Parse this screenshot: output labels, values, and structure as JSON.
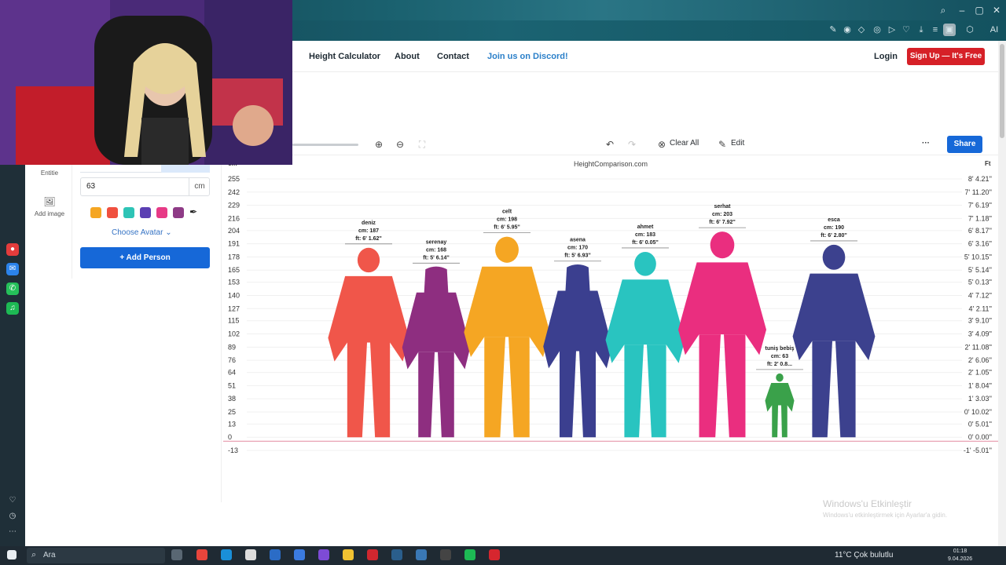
{
  "browser": {
    "ai_label": "AI"
  },
  "nav": {
    "links": [
      "Height Calculator",
      "About",
      "Contact"
    ],
    "discord": "Join us on Discord!",
    "login": "Login",
    "signup": "Sign Up — It's Free"
  },
  "toolbar": {
    "clear_all": "Clear All",
    "edit": "Edit",
    "share": "Share",
    "more": "···"
  },
  "left_panel": {
    "rail_entities": "Entitie",
    "rail_add_image": "Add image",
    "height_value": "63",
    "unit": "cm",
    "choose_avatar": "Choose Avatar",
    "add_person": "+ Add Person",
    "colors": [
      "#f5a623",
      "#f0503f",
      "#2ec4b6",
      "#5b3fb3",
      "#e73a86",
      "#8e3b86"
    ]
  },
  "chart": {
    "site": "HeightComparison.com",
    "unit_left": "cm",
    "unit_right": "Ft",
    "ticks_cm": [
      "255",
      "242",
      "229",
      "216",
      "204",
      "191",
      "178",
      "165",
      "153",
      "140",
      "127",
      "115",
      "102",
      "89",
      "76",
      "64",
      "51",
      "38",
      "25",
      "13",
      "0",
      "-13"
    ],
    "ticks_ft": [
      "8' 4.21''",
      "7' 11.20''",
      "7' 6.19''",
      "7' 1.18''",
      "6' 8.17''",
      "6' 3.16''",
      "5' 10.15''",
      "5' 5.14''",
      "5' 0.13''",
      "4' 7.12''",
      "4' 2.11''",
      "3' 9.10''",
      "3' 4.09''",
      "2' 11.08''",
      "2' 6.06''",
      "2' 1.05''",
      "1' 8.04''",
      "1' 3.03''",
      "0' 10.02''",
      "0' 5.01''",
      "0' 0.00''",
      "-1' -5.01''"
    ]
  },
  "chart_data": {
    "type": "bar",
    "title": "HeightComparison.com",
    "ylabel": "cm",
    "ylim": [
      -13,
      255
    ],
    "categories": [
      "deniz",
      "serenay",
      "celt",
      "asena",
      "ahmet",
      "serhat",
      "tuniş bebiş",
      "esca"
    ],
    "values": [
      187,
      168,
      198,
      170,
      183,
      203,
      63,
      190
    ],
    "labels_cm": [
      "cm: 187",
      "cm: 168",
      "cm: 198",
      "cm: 170",
      "cm: 183",
      "cm: 203",
      "cm: 63",
      "cm: 190"
    ],
    "labels_ft": [
      "ft: 6' 1.62''",
      "ft: 5' 6.14''",
      "ft: 6' 5.95''",
      "ft: 5' 6.93''",
      "ft: 6' 0.05''",
      "ft: 6' 7.92''",
      "ft: 2' 0.8...",
      "ft: 6' 2.80''"
    ],
    "colors": [
      "#f0564a",
      "#8e2e80",
      "#f5a623",
      "#3b3f8f",
      "#29c4c0",
      "#ea2e7f",
      "#3aa14a",
      "#3c418e"
    ],
    "genders": [
      "m",
      "f",
      "m",
      "f",
      "m",
      "m",
      "c",
      "m"
    ]
  },
  "watermark": {
    "title": "Windows'u Etkinleştir",
    "sub": "Windows'u etkinleştirmek için Ayarlar'a gidin."
  },
  "taskbar": {
    "search": "Ara",
    "weather": "11°C  Çok bulutlu",
    "time": "01:18",
    "date": "9.04.2026"
  }
}
